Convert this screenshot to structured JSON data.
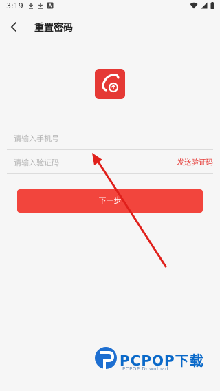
{
  "status_bar": {
    "time": "3:19"
  },
  "header": {
    "title": "重置密码"
  },
  "form": {
    "phone_placeholder": "请输入手机号",
    "code_placeholder": "请输入验证码",
    "send_code_label": "发送验证码",
    "next_label": "下一步"
  },
  "watermark": {
    "title": "PCPOP下载",
    "subtitle": "PCPOP Download"
  },
  "colors": {
    "accent": "#e53935",
    "button": "#f2453d",
    "watermark_blue": "#0a69c9"
  }
}
